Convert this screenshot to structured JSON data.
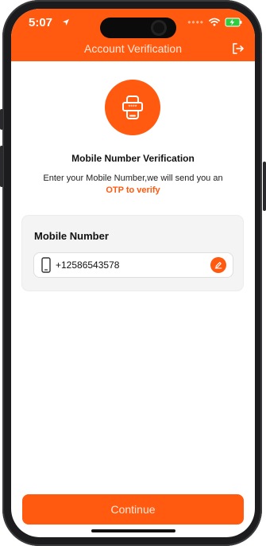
{
  "status_bar": {
    "time": "5:07",
    "icons": [
      "location-arrow-icon",
      "signal-dots-icon",
      "wifi-icon",
      "battery-charging-icon"
    ]
  },
  "header": {
    "title": "Account Verification",
    "right_icon": "logout-icon",
    "background_color": "#ff5a0f"
  },
  "verification": {
    "icon": "otp-phone-icon",
    "title": "Mobile Number Verification",
    "description_line1": "Enter your Mobile Number,we will send you an",
    "description_line2": "OTP to verify"
  },
  "mobile_card": {
    "label": "Mobile Number",
    "input_icon": "mobile-phone-icon",
    "value": "+12586543578",
    "edit_icon": "edit-pencil-icon"
  },
  "footer": {
    "continue_label": "Continue"
  },
  "colors": {
    "accent": "#ff5a0f",
    "card_background": "#f4f4f4"
  }
}
